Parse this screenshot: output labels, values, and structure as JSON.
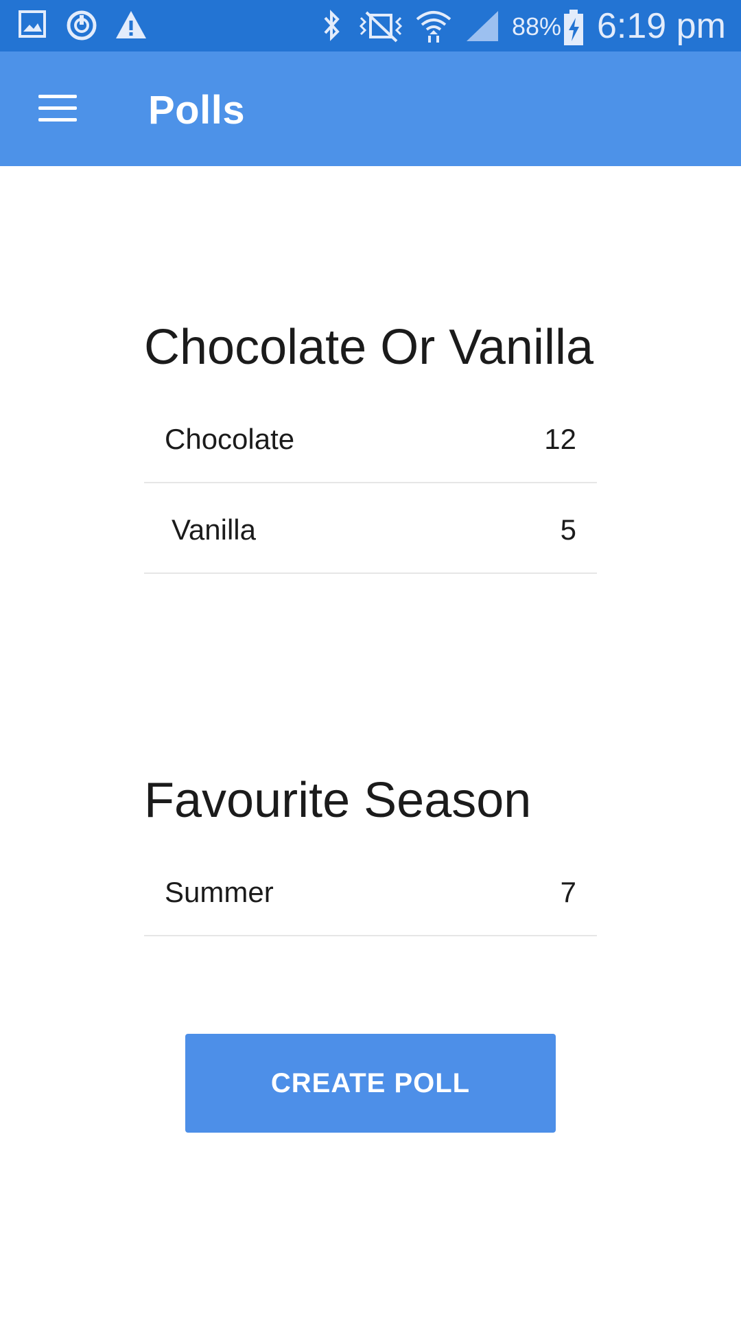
{
  "status_bar": {
    "battery": "88%",
    "time": "6:19 pm",
    "icons": [
      "gallery-icon",
      "sync-icon",
      "warning-icon",
      "bluetooth-icon",
      "vibrate-icon",
      "wifi-icon",
      "signal-icon",
      "battery-charging-icon"
    ],
    "background": "#2374d3"
  },
  "app_bar": {
    "title": "Polls",
    "menu_icon": "hamburger-menu-icon",
    "background": "#4d92e8"
  },
  "polls": [
    {
      "title": "Chocolate Or Vanilla",
      "options": [
        {
          "label": "Chocolate",
          "count": "12"
        },
        {
          "label": "Vanilla",
          "count": "5"
        }
      ]
    },
    {
      "title": "Favourite Season",
      "options": [
        {
          "label": "Summer",
          "count": "7"
        }
      ]
    }
  ],
  "actions": {
    "create_poll_label": "CREATE POLL",
    "button_color": "#4d8fe8"
  }
}
